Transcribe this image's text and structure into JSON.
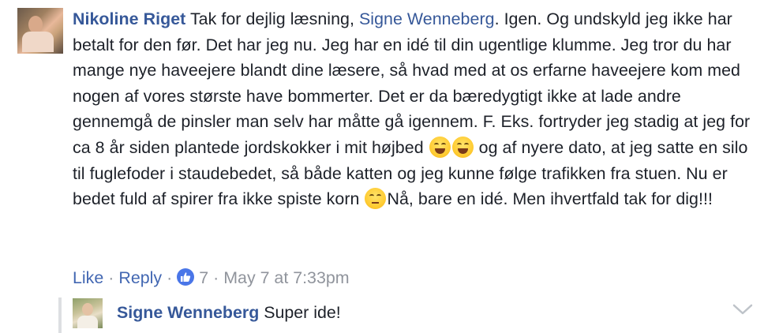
{
  "comment": {
    "author": "Nikoline Riget",
    "text_before_mention": "Tak for dejlig læsning, ",
    "mention": "Signe Wenneberg",
    "text_part1": ". Igen. Og undskyld jeg ikke har betalt for den før. Det har jeg nu. Jeg har en idé til din ugentlige klumme. Jeg tror du har mange nye haveejere blandt dine læsere, så hvad med at os erfarne haveejere kom med nogen af vores største have bommerter. Det er da bæredygtigt ikke at lade andre gennemgå de pinsler man selv har måtte gå igennem. F. Eks. fortryder jeg stadig at jeg for ca 8 år siden plantede jordskokker i mit højbed ",
    "text_part2": " og af nyere dato, at jeg satte en silo til fuglefoder i staudebedet, så både katten og jeg kunne følge trafikken fra stuen. Nu er bedet fuld af spirer fra ikke spiste korn ",
    "text_part3": "Nå, bare en idé. Men ihvertfald tak for dig!!!",
    "emojis": [
      "rolling-on-floor-laughing",
      "rolling-on-floor-laughing",
      "face-with-rolling-eyes"
    ]
  },
  "actions": {
    "like": "Like",
    "separator": "·",
    "reply": "Reply",
    "like_count": "7",
    "timestamp": "May 7 at 7:33pm"
  },
  "reply": {
    "author": "Signe Wenneberg",
    "text": "Super ide!"
  },
  "colors": {
    "link": "#365899",
    "action_link": "#4267b2",
    "meta": "#90949c",
    "like_badge": "#4a76e8"
  }
}
